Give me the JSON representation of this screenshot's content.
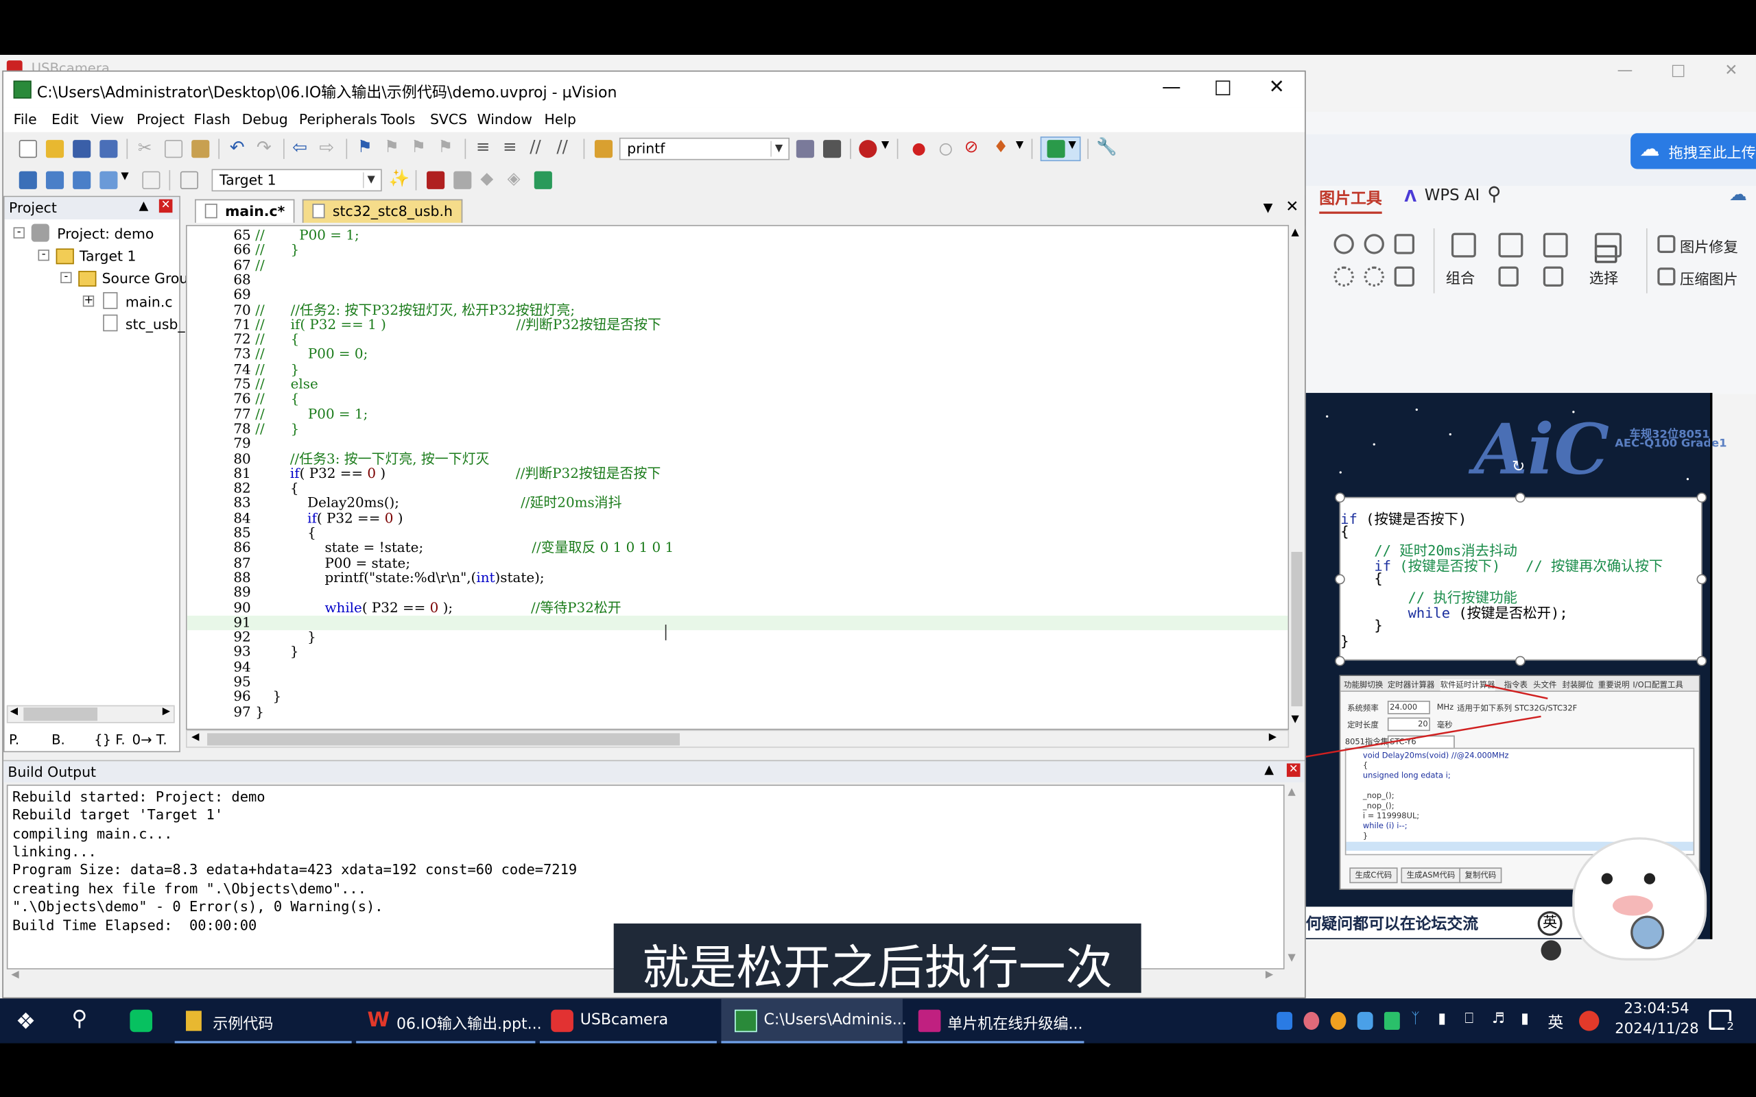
{
  "background_window": {
    "title": "USBcamera"
  },
  "wps": {
    "tabs": [
      "图片工具",
      "WPS AI"
    ],
    "share_label": "拖拽至此上传",
    "group_labels": [
      "组合",
      "选择"
    ],
    "side_buttons": [
      "图片修复",
      "压缩图片"
    ]
  },
  "slide": {
    "logo": "AiC",
    "badge_line1": "车规32位8051",
    "badge_line2": "AEC-Q100 Grade1",
    "code_lines": [
      {
        "kw": "if",
        "rest": " (按键是否按下)"
      },
      {
        "kw": "",
        "rest": "{"
      },
      {
        "kw": "",
        "rest": "    // 延时20ms消去抖动"
      },
      {
        "kw": "    if",
        "rest": " (按键是否按下)   // 按键再次确认按下"
      },
      {
        "kw": "",
        "rest": "    {"
      },
      {
        "kw": "",
        "rest": "        // 执行按键功能"
      },
      {
        "kw": "        while",
        "rest": " (按键是否松开);"
      },
      {
        "kw": "",
        "rest": "    }"
      },
      {
        "kw": "",
        "rest": "}"
      }
    ],
    "tool_tabs": [
      "功能脚切换",
      "定时器计算器",
      "软件延时计算器",
      "指令表",
      "头文件",
      "封装脚位",
      "重要说明",
      "I/O口配置工具"
    ],
    "tool_fields": [
      "系统频率",
      "24.000",
      "MHz",
      "定时长度",
      "20",
      "毫秒",
      "8051指令集",
      "STC-Y6"
    ],
    "tool_note": "适用于如下系列 STC32G/STC32F",
    "tool_code": [
      "void Delay20ms(void)    //@24.000MHz",
      "{",
      "    unsigned long edata i;",
      "",
      "    _nop_();",
      "    _nop_();",
      "    i = 119998UL;",
      "    while (i) i--;",
      "}"
    ],
    "tool_buttons": [
      "生成C代码",
      "生成ASM代码",
      "复制代码"
    ],
    "footer": "何疑问都可以在论坛交流",
    "sticker_char": "英"
  },
  "uvision": {
    "title": "C:\\Users\\Administrator\\Desktop\\06.IO输入输出\\示例代码\\demo.uvproj - µVision",
    "menu": [
      "File",
      "Edit",
      "View",
      "Project",
      "Flash",
      "Debug",
      "Peripherals",
      "Tools",
      "SVCS",
      "Window",
      "Help"
    ],
    "find_combo": "printf",
    "target_combo": "Target 1",
    "project_panel_title": "Project",
    "tree": [
      "Project: demo",
      "Target 1",
      "Source Grou",
      "main.c",
      "stc_usb_"
    ],
    "panel_tabs": [
      "P.",
      "B.",
      "{} F.",
      "0→ T."
    ],
    "editor_tabs": [
      "main.c*",
      "stc32_stc8_usb.h"
    ],
    "code": [
      {
        "n": "65",
        "t": "//        P00 = 1;"
      },
      {
        "n": "66",
        "t": "//      }"
      },
      {
        "n": "67",
        "t": "//"
      },
      {
        "n": "68",
        "t": ""
      },
      {
        "n": "69",
        "t": ""
      },
      {
        "n": "70",
        "t": "//      //任务2: 按下P32按钮灯灭, 松开P32按钮灯亮;"
      },
      {
        "n": "71",
        "t": "//      if( P32 == 1 )                              //判断P32按钮是否按下"
      },
      {
        "n": "72",
        "t": "//      {"
      },
      {
        "n": "73",
        "t": "//          P00 = 0;"
      },
      {
        "n": "74",
        "t": "//      }"
      },
      {
        "n": "75",
        "t": "//      else"
      },
      {
        "n": "76",
        "t": "//      {"
      },
      {
        "n": "77",
        "t": "//          P00 = 1;"
      },
      {
        "n": "78",
        "t": "//      }"
      },
      {
        "n": "79",
        "t": ""
      },
      {
        "n": "80",
        "t": "        //任务3: 按一下灯亮, 按一下灯灭"
      },
      {
        "n": "81",
        "t": "        if( P32 == 0 )                              //判断P32按钮是否按下"
      },
      {
        "n": "82",
        "t": "        {"
      },
      {
        "n": "83",
        "t": "            Delay20ms();                            //延时20ms消抖"
      },
      {
        "n": "84",
        "t": "            if( P32 == 0 )"
      },
      {
        "n": "85",
        "t": "            {"
      },
      {
        "n": "86",
        "t": "                state = !state;                         //变量取反 0 1 0 1 0 1"
      },
      {
        "n": "87",
        "t": "                P00 = state;"
      },
      {
        "n": "88",
        "t": "                printf(\"state:%d\\r\\n\",(int)state);"
      },
      {
        "n": "89",
        "t": ""
      },
      {
        "n": "90",
        "t": "                while( P32 == 0 );                  //等待P32松开"
      },
      {
        "n": "91",
        "t": ""
      },
      {
        "n": "92",
        "t": "            }"
      },
      {
        "n": "93",
        "t": "        }"
      },
      {
        "n": "94",
        "t": ""
      },
      {
        "n": "95",
        "t": ""
      },
      {
        "n": "96",
        "t": "    }"
      },
      {
        "n": "97",
        "t": "}"
      }
    ],
    "build_output_title": "Build Output",
    "build_output": [
      "Rebuild started: Project: demo",
      "Rebuild target 'Target 1'",
      "compiling main.c...",
      "linking...",
      "Program Size: data=8.3 edata+hdata=423 xdata=192 const=60 code=7219",
      "creating hex file from \".\\Objects\\demo\"...",
      "\".\\Objects\\demo\" - 0 Error(s), 0 Warning(s).",
      "Build Time Elapsed:  00:00:00"
    ]
  },
  "subtitle": "就是松开之后执行一次",
  "taskbar": {
    "items": [
      "示例代码",
      "06.IO输入输出.ppt...",
      "USBcamera",
      "C:\\Users\\Adminis...",
      "单片机在线升级编..."
    ],
    "ime": "英",
    "time": "23:04:54",
    "date": "2024/11/28",
    "notification_count": "2"
  },
  "colors": {
    "keyword": "#0000c8",
    "comment": "#1a7b1a",
    "taskbar": "#0b1b3a",
    "subtitle_bg": "#1f2938"
  }
}
